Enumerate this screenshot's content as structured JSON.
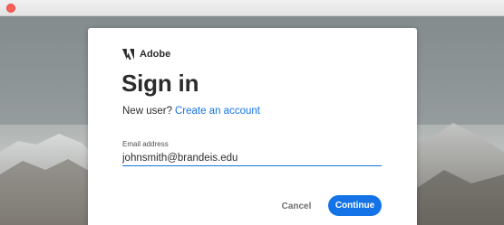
{
  "window": {
    "close_color": "#fd5f57"
  },
  "brand": {
    "name": "Adobe",
    "logo_icon": "adobe-logo-icon",
    "color": "#fa0f00"
  },
  "signin": {
    "title": "Sign in",
    "new_user_text": "New user?",
    "create_account_label": "Create an account",
    "email_label": "Email address",
    "email_value": "johnsmith@brandeis.edu",
    "cancel_label": "Cancel",
    "continue_label": "Continue"
  },
  "colors": {
    "accent": "#1473e6",
    "text": "#2c2c2c"
  }
}
